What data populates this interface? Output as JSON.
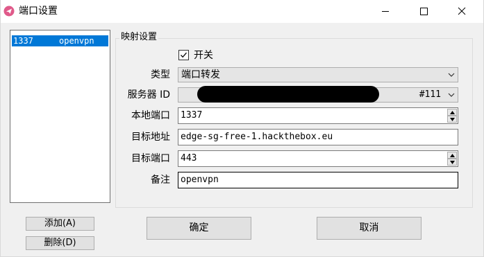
{
  "window": {
    "title": "端口设置"
  },
  "rule_list": {
    "items": [
      {
        "port": "1337",
        "name": "openvpn",
        "selected": true
      }
    ]
  },
  "group": {
    "title": "映射设置"
  },
  "form": {
    "enable_label": "开关",
    "enable_checked": true,
    "type_label": "类型",
    "type_value": "端口转发",
    "server_label": "服务器 ID",
    "server_value": "#111",
    "local_port_label": "本地端口",
    "local_port_value": "1337",
    "target_addr_label": "目标地址",
    "target_addr_value": "edge-sg-free-1.hackthebox.eu",
    "target_port_label": "目标端口",
    "target_port_value": "443",
    "note_label": "备注",
    "note_value": "openvpn"
  },
  "buttons": {
    "add": "添加(A)",
    "delete": "删除(D)",
    "ok": "确定",
    "cancel": "取消"
  },
  "colors": {
    "selection": "#0078d7",
    "window_bg": "#f0f0f0",
    "app_icon": "#e05a8a"
  },
  "icons": {
    "app": "paper-plane-icon",
    "minimize": "minimize-icon",
    "maximize": "maximize-icon",
    "close": "close-icon"
  }
}
